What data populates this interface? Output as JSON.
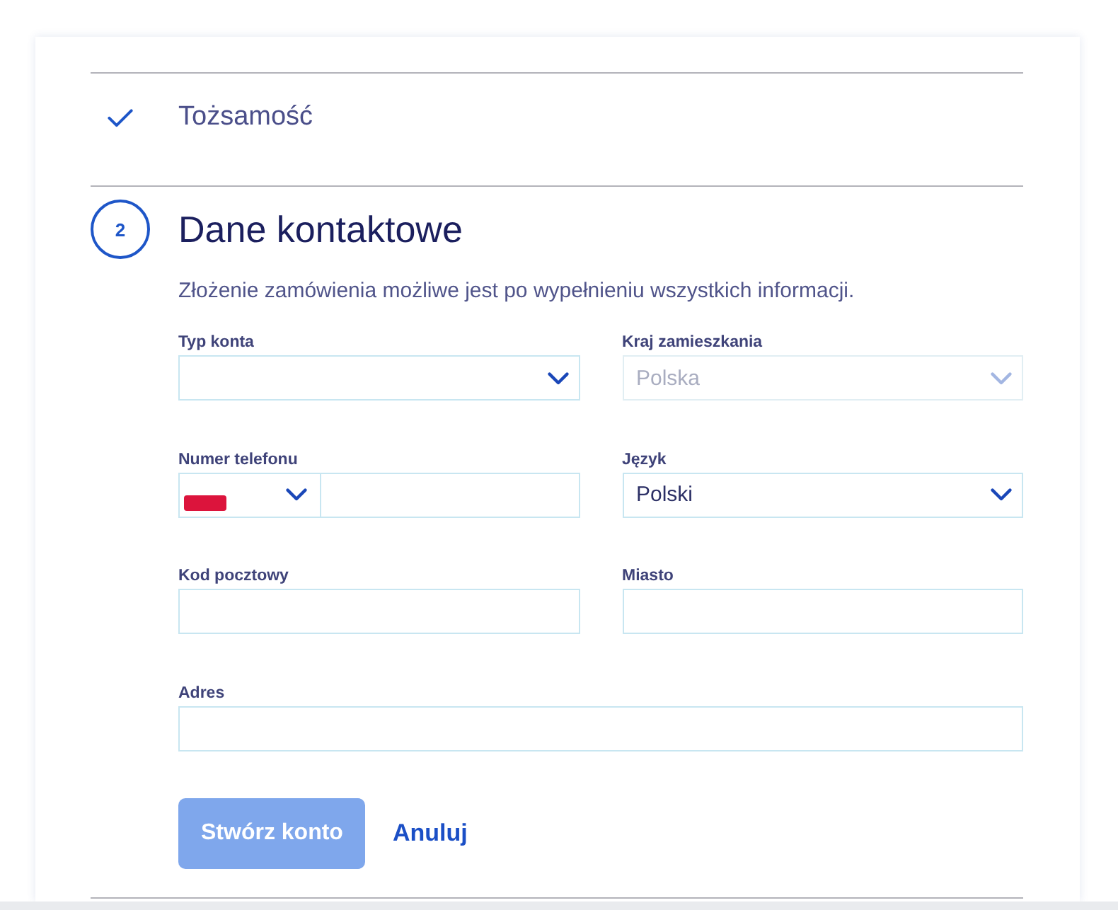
{
  "steps": [
    {
      "kind": "done",
      "title": "Tożsamość"
    },
    {
      "kind": "current",
      "number": "2",
      "title": "Dane kontaktowe",
      "description": "Złożenie zamówienia możliwe jest po wypełnieniu wszystkich informacji.",
      "rows": [
        [
          {
            "kind": "select",
            "label": "Typ konta",
            "disabled": false
          },
          {
            "kind": "select",
            "label": "Kraj zamieszkania",
            "value": "Polska",
            "disabled": true
          }
        ],
        [
          {
            "kind": "phone",
            "label": "Numer telefonu",
            "disabled": false
          },
          {
            "kind": "select",
            "label": "Język",
            "value": "Polski",
            "disabled": false
          }
        ],
        [
          {
            "kind": "text",
            "label": "Kod pocztowy",
            "disabled": false
          },
          {
            "kind": "text",
            "label": "Miasto",
            "disabled": false
          }
        ],
        [
          {
            "kind": "text",
            "label": "Adres",
            "disabled": false
          }
        ]
      ],
      "buttons": [
        {
          "kind": "primary",
          "label": "Stwórz konto",
          "disabled": true
        },
        {
          "kind": "link",
          "label": "Anuluj"
        }
      ]
    }
  ]
}
